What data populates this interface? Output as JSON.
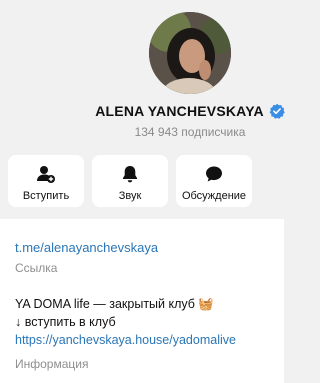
{
  "profile": {
    "name": "ALENA YANCHEVSKAYA",
    "subscribers": "134 943 подписчика"
  },
  "actions": [
    {
      "label": "Вступить",
      "icon": "join-icon"
    },
    {
      "label": "Звук",
      "icon": "bell-icon"
    },
    {
      "label": "Обсуждение",
      "icon": "chat-icon"
    }
  ],
  "info": {
    "link": "t.me/alenayanchevskaya",
    "link_caption": "Ссылка",
    "description_line1": "YA DOMA life — закрытый клуб 🧺",
    "description_line2": "↓ вступить в клуб",
    "description_url": "https://yanchevskaya.house/yadomalive",
    "description_caption": "Информация"
  },
  "colors": {
    "accent": "#2a76b6",
    "verified": "#3a8ee6"
  }
}
